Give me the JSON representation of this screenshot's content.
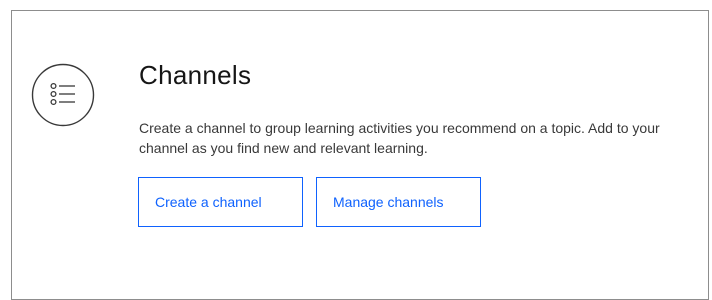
{
  "card": {
    "title": "Channels",
    "description": "Create a channel to group learning activities you recommend on a topic. Add to your channel as you find new and relevant learning.",
    "icon": "list-icon",
    "buttons": {
      "create_label": "Create a channel",
      "manage_label": "Manage channels"
    }
  },
  "colors": {
    "accent": "#0f62fe",
    "title_text": "#161616",
    "body_text": "#393939",
    "border": "#8d8d8d"
  }
}
